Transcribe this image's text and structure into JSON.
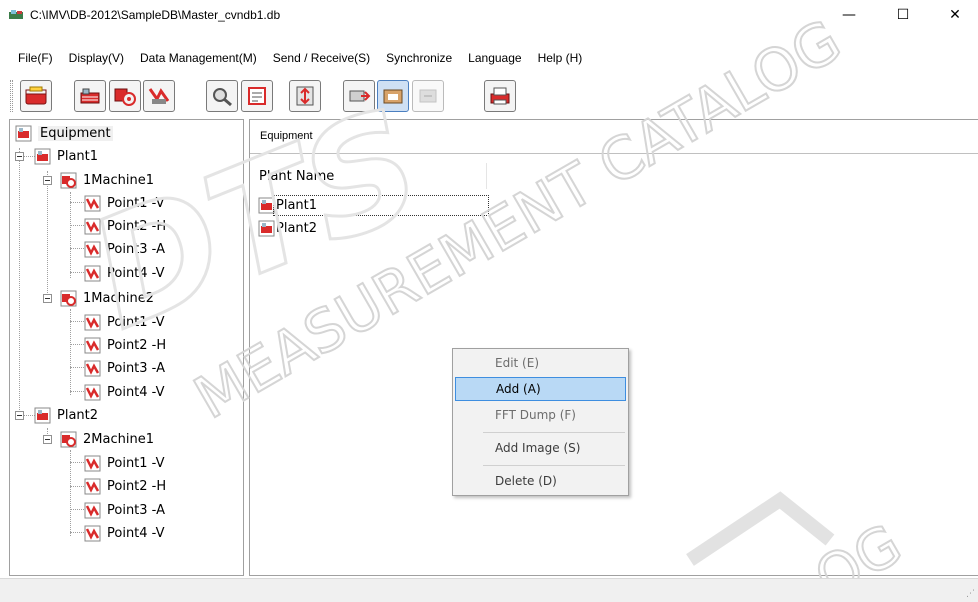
{
  "window": {
    "title": "C:\\IMV\\DB-2012\\SampleDB\\Master_cvndb1.db",
    "minimize_glyph": "—",
    "maximize_glyph": "☐",
    "close_glyph": "✕"
  },
  "menu": [
    "File(F)",
    "Display(V)",
    "Data Management(M)",
    "Send / Receive(S)",
    "Synchronize",
    "Language",
    "Help (H)"
  ],
  "toolbar": {
    "buttons": [
      "open-database-icon",
      "plant-equipment-icon",
      "machine-settings-icon",
      "measurement-point-icon",
      "sensor-search-icon",
      "route-list-icon",
      "data-transfer-icon",
      "send-device-icon",
      "receive-device-icon",
      "sync-device-icon",
      "print-report-icon"
    ]
  },
  "tree": {
    "root": "Equipment",
    "plant1": "Plant1",
    "machine1": "1Machine1",
    "machine2": "1Machine2",
    "plant2": "Plant2",
    "machine3": "2Machine1",
    "points": [
      "Point1 -V",
      "Point2 -H",
      "Point3 -A",
      "Point4 -V"
    ]
  },
  "panel": {
    "tab_label": "Equipment",
    "column_header": "Plant Name",
    "rows": [
      "Plant1",
      "Plant2"
    ]
  },
  "context_menu": {
    "items": [
      "Edit (E)",
      "Add (A)",
      "FFT Dump (F)",
      "Add Image (S)",
      "Delete (D)"
    ]
  },
  "watermark": {
    "line1": "MEASUREMENT CATALOG",
    "logo": "DTS",
    "line2": "OG"
  },
  "colors": {
    "highlight": "#b9d9f5",
    "highlight_border": "#3e8ee0",
    "icon_red": "#d92b2b"
  }
}
